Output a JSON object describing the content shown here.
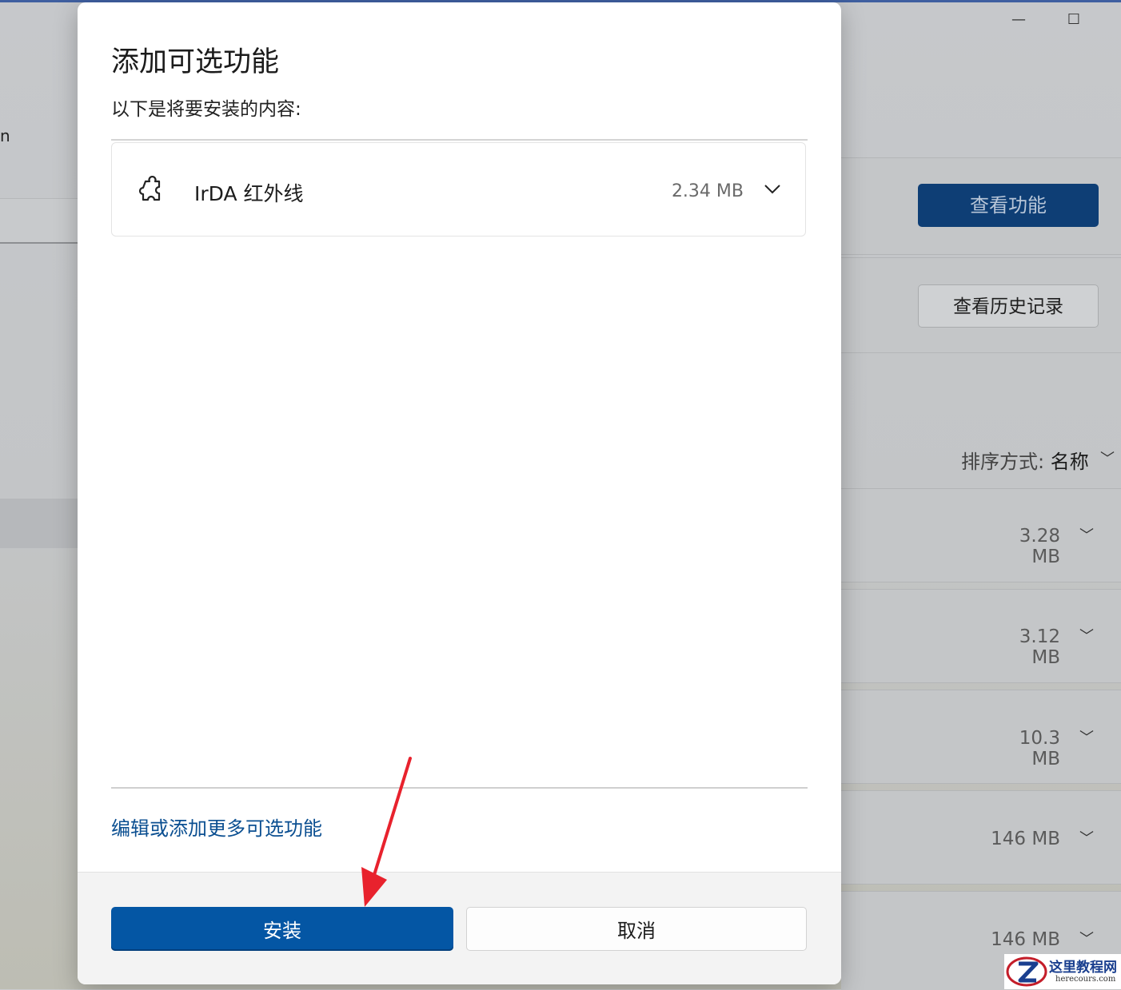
{
  "background": {
    "left_partial_text": "n",
    "view_features_button": "查看功能",
    "view_history_button": "查看历史记录",
    "sort_label": "排序方式:",
    "sort_value": "名称",
    "row_sizes": [
      "3.28 MB",
      "3.12 MB",
      "10.3 MB",
      "146 MB",
      "146 MB"
    ]
  },
  "dialog": {
    "title": "添加可选功能",
    "subtitle": "以下是将要安装的内容:",
    "feature": {
      "icon": "puzzle-piece-icon",
      "name": "IrDA 红外线",
      "size": "2.34 MB"
    },
    "edit_link": "编辑或添加更多可选功能",
    "install_button": "安装",
    "cancel_button": "取消"
  },
  "watermark": {
    "title": "这里教程网",
    "url": "herecours.com"
  },
  "colors": {
    "accent": "#0456a4",
    "link": "#0b4f91",
    "annotation_arrow": "#e8222d"
  }
}
